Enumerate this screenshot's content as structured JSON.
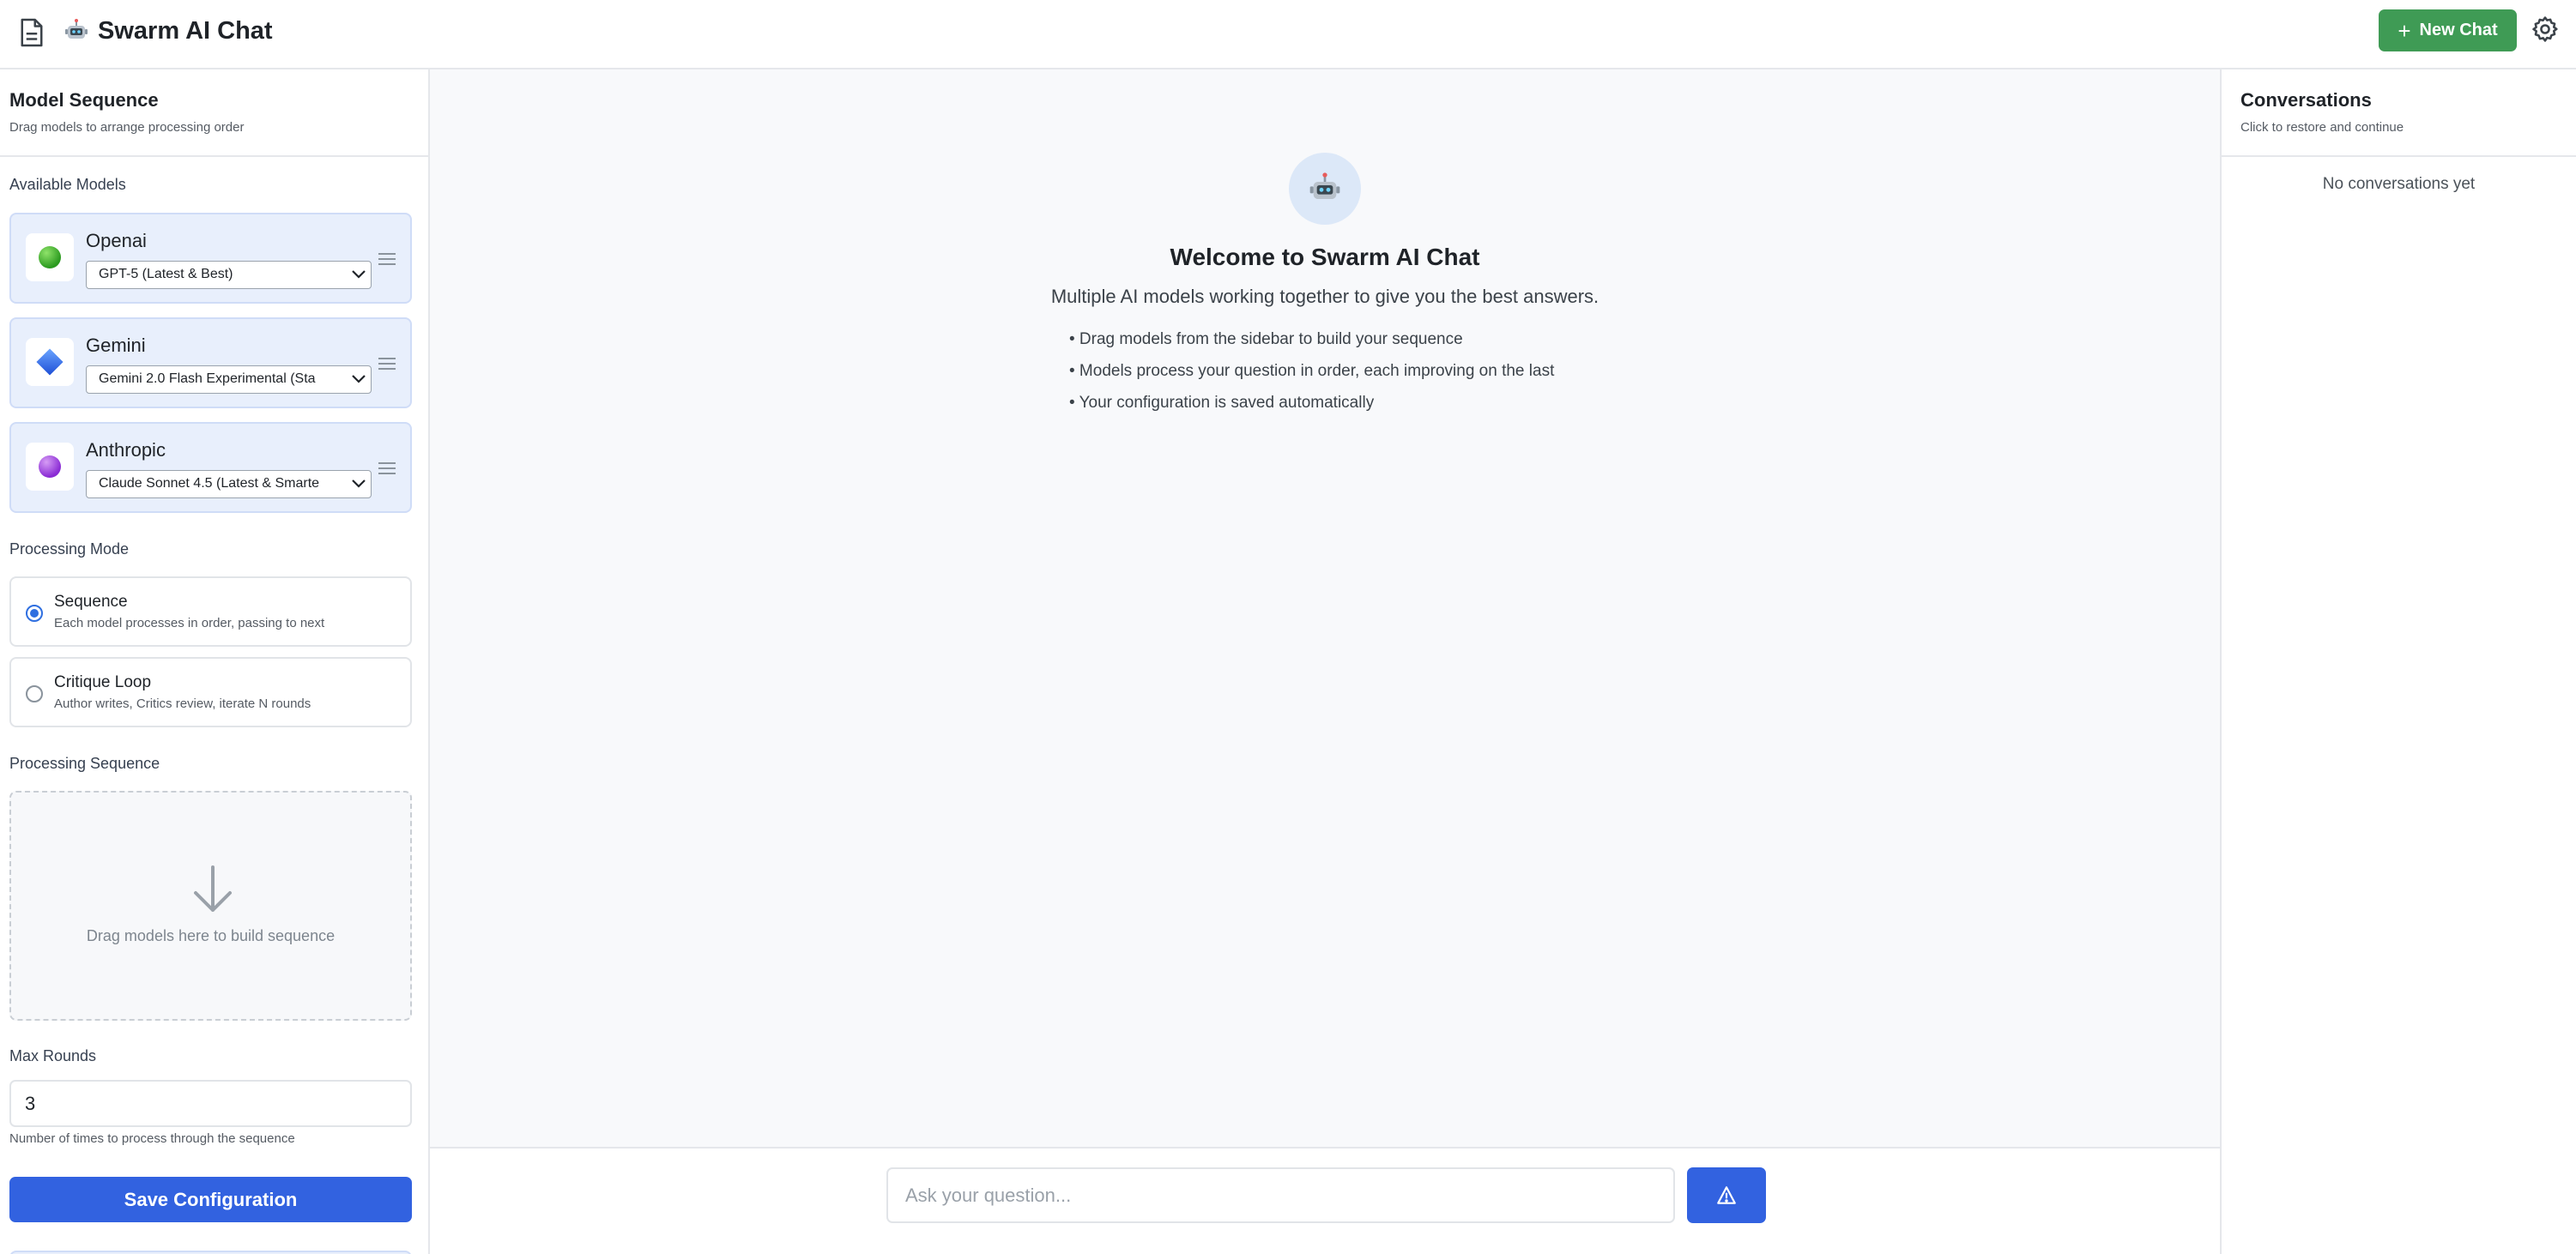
{
  "header": {
    "app_title": "Swarm AI Chat",
    "new_chat_label": "New Chat"
  },
  "sidebar": {
    "title": "Model Sequence",
    "subtitle": "Drag models to arrange processing order",
    "available_label": "Available Models",
    "models": [
      {
        "name": "Openai",
        "selected": "GPT-5 (Latest & Best)",
        "icon": "green-circle-icon"
      },
      {
        "name": "Gemini",
        "selected": "Gemini 2.0 Flash Experimental (Sta",
        "icon": "blue-diamond-icon"
      },
      {
        "name": "Anthropic",
        "selected": "Claude Sonnet 4.5 (Latest & Smarte",
        "icon": "purple-circle-icon"
      }
    ],
    "processing_mode_label": "Processing Mode",
    "modes": [
      {
        "title": "Sequence",
        "desc": "Each model processes in order, passing to next",
        "checked": true
      },
      {
        "title": "Critique Loop",
        "desc": "Author writes, Critics review, iterate N rounds",
        "checked": false
      }
    ],
    "sequence_label": "Processing Sequence",
    "drop_hint": "Drag models here to build sequence",
    "max_rounds_label": "Max Rounds",
    "max_rounds_value": "3",
    "max_rounds_help": "Number of times to process through the sequence",
    "save_label": "Save Configuration"
  },
  "main": {
    "welcome_title": "Welcome to Swarm AI Chat",
    "welcome_subtitle": "Multiple AI models working together to give you the best answers.",
    "tips": [
      "• Drag models from the sidebar to build your sequence",
      "• Models process your question in order, each improving on the last",
      "• Your configuration is saved automatically"
    ],
    "input_placeholder": "Ask your question..."
  },
  "conversations": {
    "title": "Conversations",
    "subtitle": "Click to restore and continue",
    "empty_text": "No conversations yet"
  },
  "colors": {
    "accent_blue": "#3262e0",
    "new_chat_green": "#3f9b55",
    "card_bg": "#e8effc"
  }
}
